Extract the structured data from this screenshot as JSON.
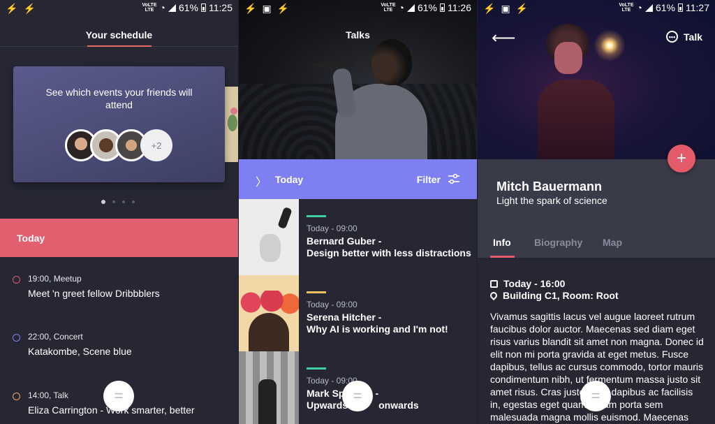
{
  "status_bars": [
    {
      "time": "11:25",
      "battery": "61%",
      "network": [
        "VoLTE",
        "LTE"
      ]
    },
    {
      "time": "11:26",
      "battery": "61%",
      "network": [
        "VoLTE",
        "LTE"
      ]
    },
    {
      "time": "11:27",
      "battery": "61%",
      "network": [
        "VoLTE",
        "LTE"
      ]
    }
  ],
  "schedule": {
    "title": "Your schedule",
    "card_text": "See which events your friends will attend",
    "more_friends": "+2",
    "section": "Today",
    "events": [
      {
        "meta": "19:00, Meetup",
        "title": "Meet 'n greet fellow Dribbblers",
        "color": "#e35b6b"
      },
      {
        "meta": "22:00, Concert",
        "title": "Katakombe, Scene blue",
        "color": "#7e7ff0"
      },
      {
        "meta": "14:00, Talk",
        "title": "Eliza Carrington - Work smarter, better",
        "color": "#f0a36a"
      }
    ],
    "fab_icon": "="
  },
  "talks": {
    "title": "Talks",
    "day": "Today",
    "filter_label": "Filter",
    "items": [
      {
        "time": "Today - 09:00",
        "speaker": "Bernard Guber -",
        "talk": "Design better with less distractions",
        "accent": "#3ecfa3"
      },
      {
        "time": "Today - 09:00",
        "speaker": "Serena Hitcher -",
        "talk": "Why AI is working and I'm not!",
        "accent": "#f0c060"
      },
      {
        "time": "Today - 09:00",
        "speaker": "Mark Sp",
        "talk": "Upwards",
        "talk_tail": "onwards",
        "speaker_tail": "-",
        "accent": "#3ecfa3"
      }
    ],
    "fab_icon": "="
  },
  "detail": {
    "talk_chip": "Talk",
    "name": "Mitch Bauermann",
    "subtitle": "Light the spark of science",
    "tabs": [
      "Info",
      "Biography",
      "Map"
    ],
    "datetime": "Today - 16:00",
    "location": "Building C1, Room: Root",
    "body": "Vivamus sagittis lacus vel augue laoreet rutrum faucibus dolor auctor. Maecenas sed diam eget risus varius blandit sit amet non magna. Donec id elit non mi porta gravida at eget metus. Fusce dapibus, tellus ac cursus commodo, tortor mauris condimentum nibh, ut fermentum massa justo sit amet risus. Cras justo odio, dapibus ac facilisis in, egestas eget quam. Etiam porta sem malesuada magna mollis euismod. Maecenas faucibus mollis interdum.",
    "fab_icon": "+"
  },
  "colors": {
    "accent_red": "#e35b6b",
    "accent_purple": "#7e7ff0",
    "bg_dark": "#262733"
  }
}
